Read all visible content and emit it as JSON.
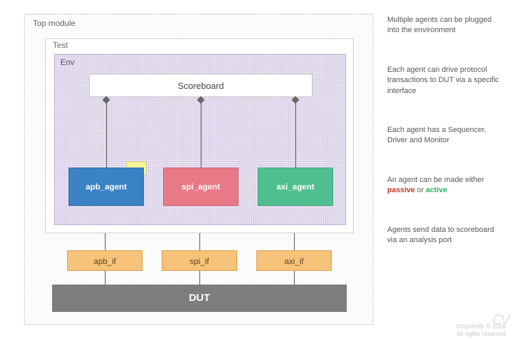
{
  "top_label": "Top module",
  "test_label": "Test",
  "env_label": "Env",
  "scoreboard": "Scoreboard",
  "agents": {
    "apb": "apb_agent",
    "spi": "spi_agent",
    "axi": "axi_agent"
  },
  "ifs": {
    "apb": "apb_if",
    "spi": "spi_if",
    "axi": "axi_if"
  },
  "dut": "DUT",
  "notes": {
    "n1": "Multiple agents can be plugged into the environment",
    "n2": "Each agent can drive protocol transactions to DUT via a specific interface",
    "n3": "Each agent has a Sequencer, Driver and Monitor",
    "n4_pre": "An agent can be made either ",
    "n4_passive": "passive",
    "n4_mid": " or ",
    "n4_active": "active",
    "n5": "Agents send data to scoreboard via an analysis port"
  },
  "footer": {
    "l1": "ChipVerify © 2016",
    "l2": "All rights reserved"
  },
  "logo": "CV"
}
